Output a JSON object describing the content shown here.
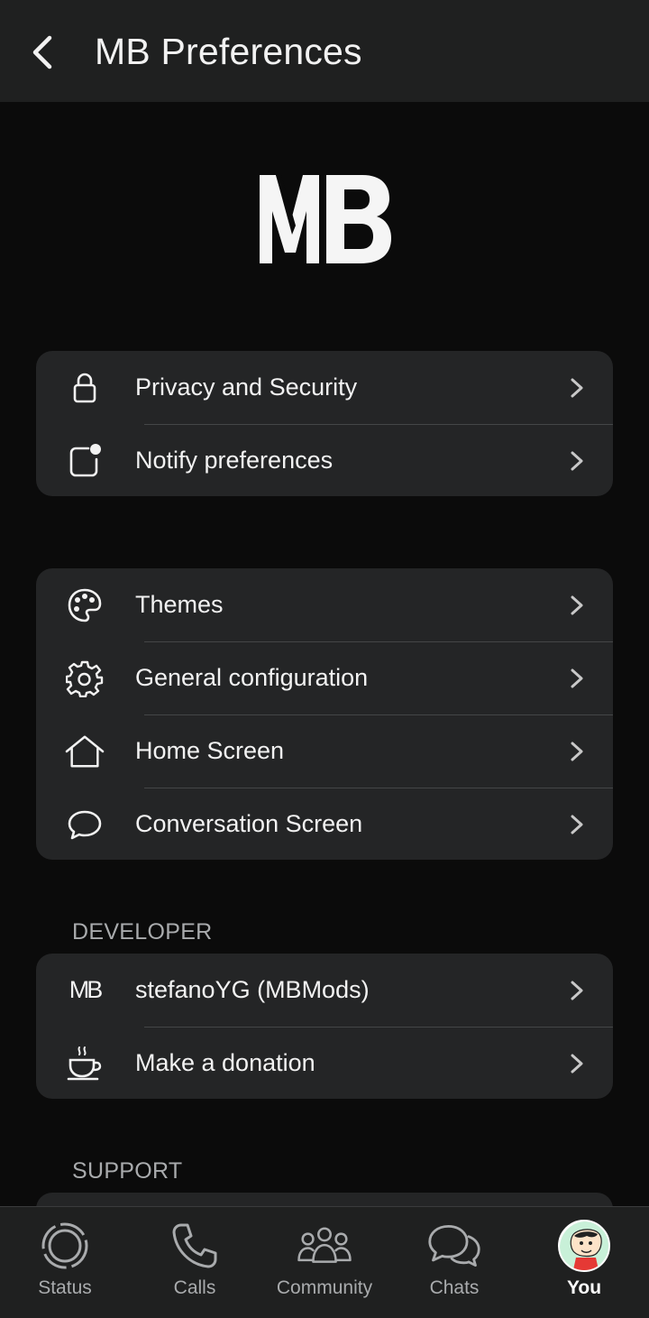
{
  "header": {
    "title": "MB Preferences"
  },
  "logo": {
    "text": "MB"
  },
  "group1": {
    "items": [
      {
        "label": "Privacy and Security",
        "icon": "lock-icon"
      },
      {
        "label": "Notify preferences",
        "icon": "notification-badge-icon"
      }
    ]
  },
  "group2": {
    "items": [
      {
        "label": "Themes",
        "icon": "palette-icon"
      },
      {
        "label": "General configuration",
        "icon": "gear-icon"
      },
      {
        "label": "Home Screen",
        "icon": "home-icon"
      },
      {
        "label": "Conversation Screen",
        "icon": "chat-bubble-icon"
      }
    ]
  },
  "developer": {
    "title": "DEVELOPER",
    "items": [
      {
        "label": "stefanoYG (MBMods)",
        "icon": "mb-icon",
        "icon_text": "MB"
      },
      {
        "label": "Make a donation",
        "icon": "coffee-cup-icon"
      }
    ]
  },
  "support": {
    "title": "SUPPORT"
  },
  "bottom_nav": {
    "items": [
      {
        "label": "Status",
        "icon": "status-icon"
      },
      {
        "label": "Calls",
        "icon": "phone-icon"
      },
      {
        "label": "Community",
        "icon": "community-icon"
      },
      {
        "label": "Chats",
        "icon": "chats-icon"
      },
      {
        "label": "You",
        "icon": "avatar",
        "active": true
      }
    ]
  },
  "colors": {
    "background": "#0b0b0b",
    "header": "#1f2020",
    "card": "#242526",
    "text": "#f2f2f2",
    "muted": "#a9abad"
  }
}
